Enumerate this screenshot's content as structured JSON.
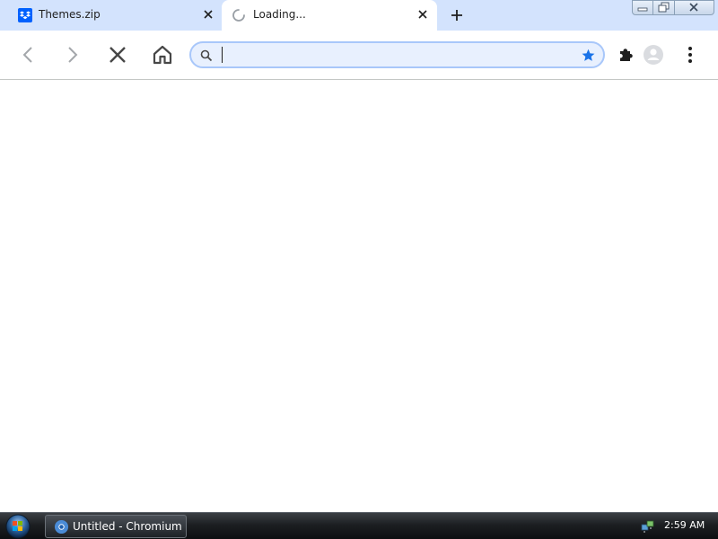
{
  "browser": {
    "tabs": [
      {
        "title": "Themes.zip",
        "favicon": "dropbox-icon",
        "active": false
      },
      {
        "title": "Loading...",
        "favicon": "loading-spinner-icon",
        "active": true
      }
    ],
    "new_tab_icon": "plus-icon",
    "window_controls": [
      "minimize-icon",
      "restore-icon",
      "close-icon"
    ]
  },
  "toolbar": {
    "buttons": [
      "back-icon",
      "forward-icon",
      "stop-icon",
      "home-icon"
    ],
    "omnibox": {
      "value": "",
      "placeholder": "",
      "search_icon": "search-icon",
      "bookmark_icon": "star-icon"
    },
    "right_icons": [
      "extensions-icon",
      "profile-icon",
      "menu-icon"
    ]
  },
  "taskbar": {
    "start": "windows-orb-icon",
    "window_title": "Untitled - Chromium",
    "window_icon": "chromium-icon",
    "tray_icon": "network-icon",
    "clock": "2:59 AM"
  },
  "colors": {
    "tab_strip": "#d3e3fd",
    "omnibox_fill": "#e8f0fe",
    "omnibox_border": "#a8c7fa",
    "star": "#1a73e8",
    "taskbar": "#1c1f22"
  }
}
